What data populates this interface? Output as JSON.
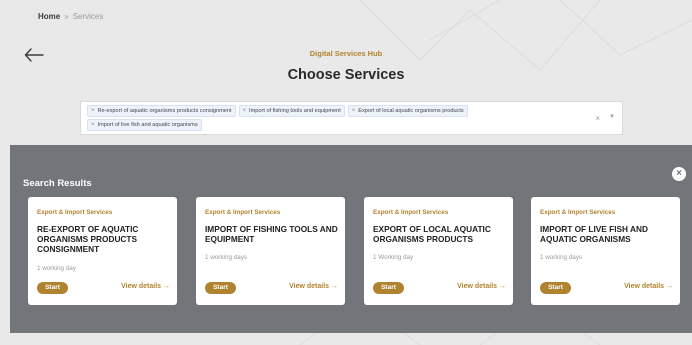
{
  "breadcrumb": {
    "home": "Home",
    "separator": "»",
    "current": "Services"
  },
  "back_icon": "arrow-left-icon",
  "hub_label": "Digital Services Hub",
  "page_title": "Choose Services",
  "select": {
    "chips": [
      "Re-export of aquatic organisms products consignment",
      "Import of fishing tools and equipment",
      "Export of local aquatic organisms products",
      "Import of live fish and aquatic organisms"
    ],
    "clear_label": "×",
    "caret_icon": "caret-down-icon"
  },
  "results": {
    "title": "Search Results",
    "close_icon": "close-circle-icon",
    "cards": [
      {
        "category": "Export & Import Services",
        "name": "RE-EXPORT OF AQUATIC ORGANISMS PRODUCTS CONSIGNMENT",
        "time": "1 working day",
        "start": "Start",
        "details": "View details →"
      },
      {
        "category": "Export & Import Services",
        "name": "IMPORT OF FISHING TOOLS AND EQUIPMENT",
        "time": "1 working days",
        "start": "Start",
        "details": "View details →"
      },
      {
        "category": "Export & Import Services",
        "name": "EXPORT OF LOCAL AQUATIC ORGANISMS PRODUCTS",
        "time": "1 Working day",
        "start": "Start",
        "details": "View details →"
      },
      {
        "category": "Export & Import Services",
        "name": "IMPORT OF LIVE FISH AND AQUATIC ORGANISMS",
        "time": "1 working days",
        "start": "Start",
        "details": "View details →"
      }
    ]
  },
  "colors": {
    "accent": "#b0832e",
    "overlay": "#72767a",
    "background": "#e9e9ea"
  }
}
